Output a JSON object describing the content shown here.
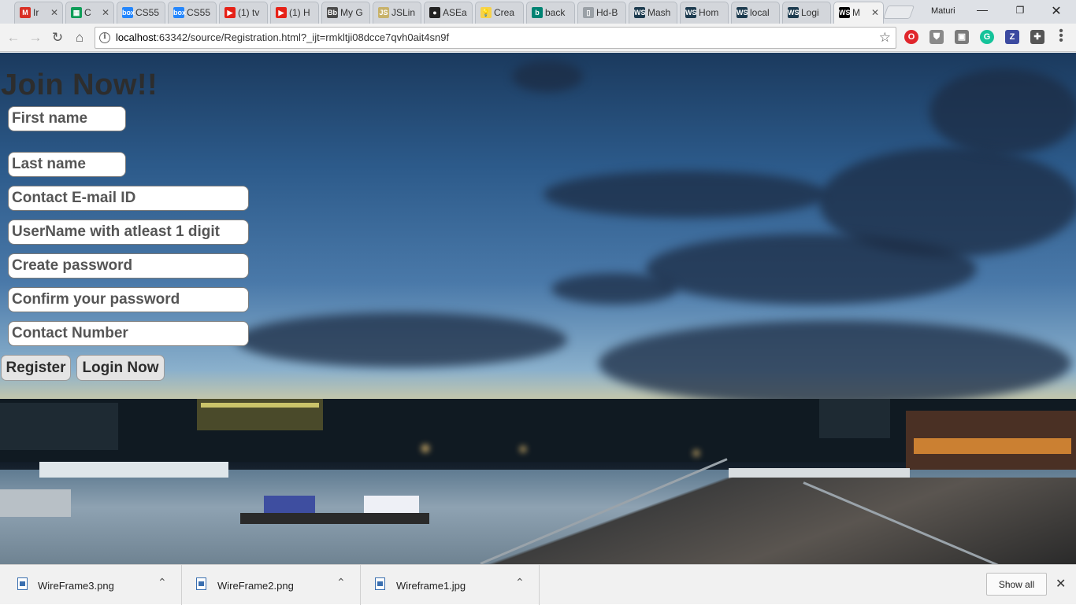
{
  "browser": {
    "tabs": [
      {
        "title": "Ir",
        "icon": "gmail-icon",
        "color": "#d93025",
        "glyph": "M"
      },
      {
        "title": "C",
        "icon": "sheets-icon",
        "color": "#0f9d58",
        "glyph": "▦"
      },
      {
        "title": "CS55",
        "icon": "box-icon",
        "color": "#2486fc",
        "glyph": "box"
      },
      {
        "title": "CS55",
        "icon": "box-icon",
        "color": "#2486fc",
        "glyph": "box"
      },
      {
        "title": "(1) tv",
        "icon": "youtube-icon",
        "color": "#e62117",
        "glyph": "▶"
      },
      {
        "title": "(1) H",
        "icon": "youtube-icon",
        "color": "#e62117",
        "glyph": "▶"
      },
      {
        "title": "My G",
        "icon": "blackboard-icon",
        "color": "#4b4b4b",
        "glyph": "Bb"
      },
      {
        "title": "JSLin",
        "icon": "jslint-icon",
        "color": "#c8b26a",
        "glyph": "JS"
      },
      {
        "title": "ASEa",
        "icon": "github-icon",
        "color": "#222222",
        "glyph": "●"
      },
      {
        "title": "Crea",
        "icon": "lightbulb-icon",
        "color": "#f6d24a",
        "glyph": "💡"
      },
      {
        "title": "back",
        "icon": "bing-icon",
        "color": "#008373",
        "glyph": "b"
      },
      {
        "title": "Hd-B",
        "icon": "document-icon",
        "color": "#9aa0a6",
        "glyph": "▯"
      },
      {
        "title": "Mash",
        "icon": "webstorm-icon",
        "color": "#1d3b4f",
        "glyph": "WS"
      },
      {
        "title": "Hom",
        "icon": "webstorm-icon",
        "color": "#1d3b4f",
        "glyph": "WS"
      },
      {
        "title": "local",
        "icon": "webstorm-icon",
        "color": "#1d3b4f",
        "glyph": "WS"
      },
      {
        "title": "Logi",
        "icon": "webstorm-icon",
        "color": "#1d3b4f",
        "glyph": "WS"
      },
      {
        "title": "M",
        "icon": "webstorm-icon",
        "color": "#000000",
        "glyph": "WS"
      }
    ],
    "profile_name": "Maturi",
    "url_host": "localhost",
    "url_rest": ":63342/source/Registration.html?_ijt=rmkltji08dcce7qvh0ait4sn9f",
    "extensions": [
      {
        "name": "opera-icon",
        "color": "#e0262c",
        "glyph": "O"
      },
      {
        "name": "shield-icon",
        "color": "#8a8a8a",
        "glyph": "⛊"
      },
      {
        "name": "extension-icon",
        "color": "#7b7b7b",
        "glyph": "▣"
      },
      {
        "name": "grammarly-icon",
        "color": "#15c39a",
        "glyph": "G"
      },
      {
        "name": "zotero-icon",
        "color": "#3c4aa0",
        "glyph": "Z"
      },
      {
        "name": "puzzle-icon",
        "color": "#555555",
        "glyph": "✚"
      }
    ]
  },
  "page": {
    "title": "Join Now!!",
    "fields": {
      "first_name": "First name",
      "last_name": "Last name",
      "email": "Contact E-mail ID",
      "username": "UserName with atleast 1 digit",
      "password": "Create password",
      "confirm_password": "Confirm your password",
      "phone": "Contact Number"
    },
    "register_label": "Register",
    "login_label": "Login Now"
  },
  "downloads": {
    "items": [
      "WireFrame3.png",
      "WireFrame2.png",
      "Wireframe1.jpg"
    ],
    "show_all_label": "Show all"
  }
}
